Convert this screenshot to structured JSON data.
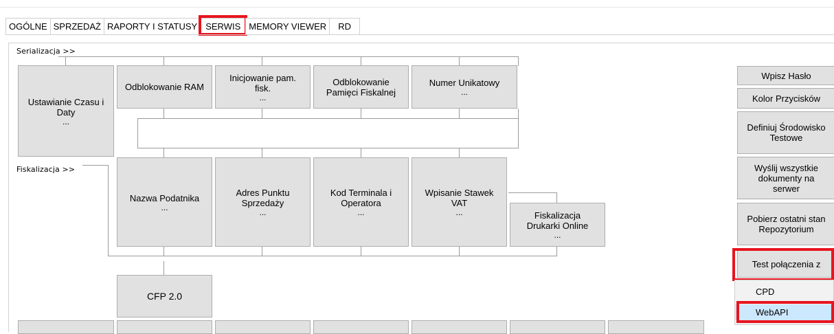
{
  "tabs": [
    {
      "label": "OGÓLNE"
    },
    {
      "label": "SPRZEDAŻ"
    },
    {
      "label": "RAPORTY I STATUSY"
    },
    {
      "label": "SERWIS",
      "active": true
    },
    {
      "label": "MEMORY VIEWER"
    },
    {
      "label": "RD"
    }
  ],
  "sections": {
    "serializacja": "Serializacja >>",
    "fiskalizacja": "Fiskalizacja >>"
  },
  "row1": {
    "czas": {
      "label": "Ustawianie Czasu i Daty",
      "dots": "..."
    },
    "ram": {
      "label": "Odblokowanie RAM"
    },
    "inicjowanie": {
      "label": "Inicjowanie pam. fisk.",
      "dots": "..."
    },
    "odblokowanie_pamieci": {
      "label": "Odblokowanie Pamięci Fiskalnej"
    },
    "numer": {
      "label": "Numer Unikatowy",
      "dots": "..."
    }
  },
  "row2": {
    "nazwa": {
      "label": "Nazwa Podatnika",
      "dots": "..."
    },
    "adres": {
      "label": "Adres Punktu Sprzedaży",
      "dots": "..."
    },
    "kod": {
      "label": "Kod Terminala i Operatora",
      "dots": "..."
    },
    "stawki": {
      "label": "Wpisanie Stawek VAT",
      "dots": "..."
    },
    "fisk_online": {
      "label": "Fiskalizacja Drukarki Online",
      "dots": "..."
    }
  },
  "cfp": {
    "label": "CFP 2.0"
  },
  "right_buttons": {
    "haslo": "Wpisz Hasło",
    "kolor": "Kolor Przycisków",
    "srodowisko": "Definiuj Środowisko Testowe",
    "wyslij": "Wyślij wszystkie dokumenty na serwer",
    "pobierz": "Pobierz ostatni stan Repozytorium",
    "test": "Test połączenia z"
  },
  "dropdown": {
    "items": [
      {
        "label": "CPD"
      },
      {
        "label": "WebAPI",
        "selected": true
      }
    ],
    "selected_color": "#cce8ff"
  },
  "colors": {
    "highlight": "#e8141f",
    "button_bg": "#e1e1e1"
  }
}
